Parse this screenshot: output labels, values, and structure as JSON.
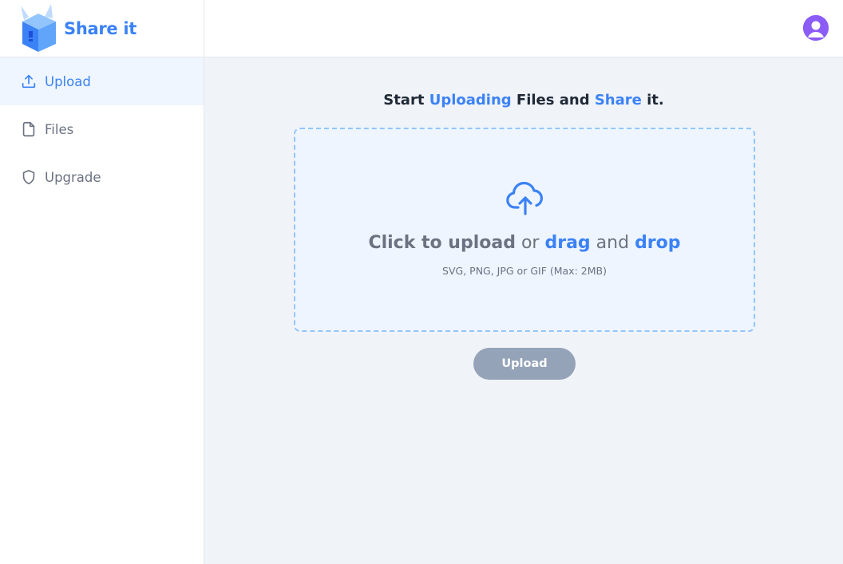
{
  "brand": {
    "name": "Share it",
    "color": "#3b82f6"
  },
  "sidebar": {
    "items": [
      {
        "label": "Upload",
        "icon": "upload-icon",
        "active": true
      },
      {
        "label": "Files",
        "icon": "file-icon",
        "active": false
      },
      {
        "label": "Upgrade",
        "icon": "shield-icon",
        "active": false
      }
    ]
  },
  "header": {
    "avatar_icon": "user-avatar-icon"
  },
  "main": {
    "headline": {
      "part1": "Start ",
      "highlight1": "Uploading",
      "part2": " Files and ",
      "highlight2": "Share",
      "part3": " it."
    },
    "dropzone": {
      "icon": "cloud-upload-icon",
      "title_bold": "Click to upload",
      "title_or": " or ",
      "title_drag": "drag",
      "title_and": " and ",
      "title_drop": "drop",
      "hint": "SVG, PNG, JPG or GIF (Max: 2MB)"
    },
    "upload_button_label": "Upload"
  }
}
